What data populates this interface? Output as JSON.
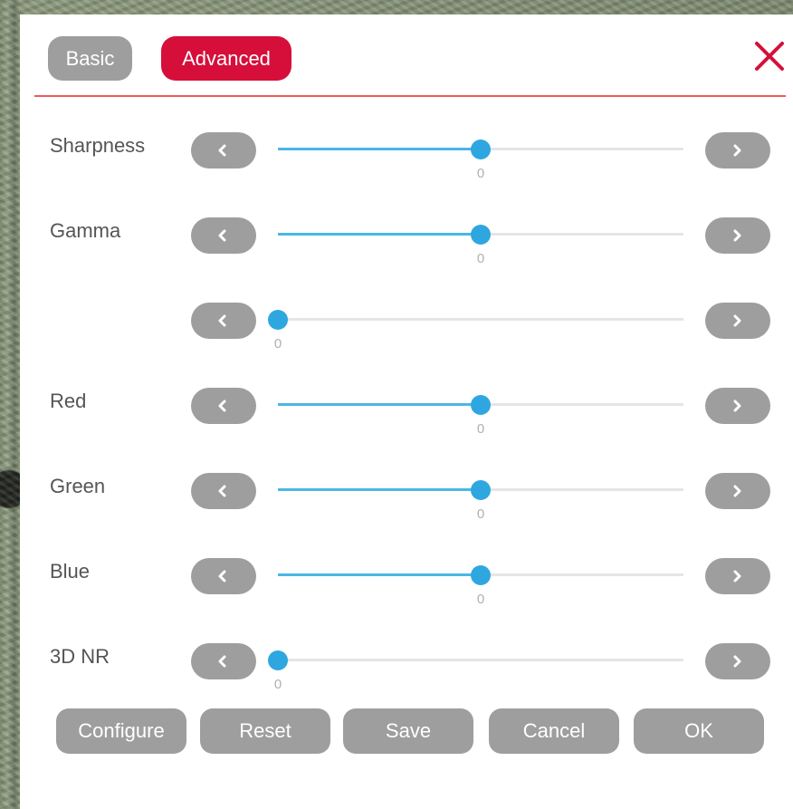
{
  "tabs": {
    "basic": "Basic",
    "advanced": "Advanced"
  },
  "colors": {
    "accent": "#d60f3a",
    "slider": "#2ea7e0",
    "button": "#9e9e9e"
  },
  "sliders": [
    {
      "label": "Sharpness",
      "value": "0",
      "level": 0.5
    },
    {
      "label": "Gamma",
      "value": "0",
      "level": 0.5
    },
    {
      "label": "",
      "value": "0",
      "level": 0.0
    },
    {
      "label": "Red",
      "value": "0",
      "level": 0.5
    },
    {
      "label": "Green",
      "value": "0",
      "level": 0.5
    },
    {
      "label": "Blue",
      "value": "0",
      "level": 0.5
    },
    {
      "label": "3D NR",
      "value": "0",
      "level": 0.0
    }
  ],
  "actions": {
    "configure": "Configure",
    "reset": "Reset",
    "save": "Save",
    "cancel": "Cancel",
    "ok": "OK"
  },
  "icons": {
    "close": "close-icon",
    "decrease": "chevron-left-icon",
    "increase": "chevron-right-icon"
  }
}
